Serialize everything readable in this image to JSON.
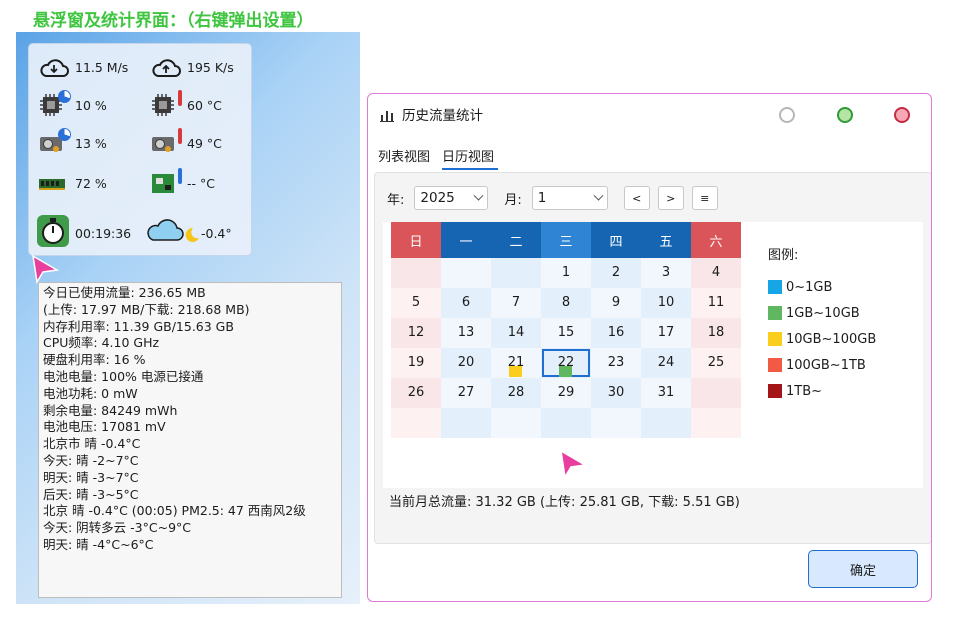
{
  "heading": "悬浮窗及统计界面：（右键弹出设置）",
  "float_window": {
    "net_down": "11.5 M/s",
    "net_up": "195 K/s",
    "cpu_usage": "10 %",
    "cpu_temp": "60 °C",
    "gpu_usage": "13 %",
    "gpu_temp": "49 °C",
    "memory_usage": "72 %",
    "board_temp": "-- °C",
    "uptime": "00:19:36",
    "weather_temp": "-0.4°"
  },
  "tooltip": {
    "lines": [
      "今日已使用流量: 236.65 MB",
      " (上传: 17.97 MB/下载: 218.68 MB)",
      "内存利用率: 11.39 GB/15.63 GB",
      "CPU频率: 4.10 GHz",
      "硬盘利用率: 16 %",
      "电池电量: 100% 电源已接通",
      "电池功耗:  0 mW",
      "剩余电量:  84249 mWh",
      "电池电压:  17081 mV",
      "北京市 晴 -0.4°C",
      "今天: 晴 -2~7°C",
      "明天: 晴 -3~7°C",
      "后天: 晴 -3~5°C",
      "北京 晴 -0.4°C (00:05) PM2.5: 47  西南风2级",
      "今天: 阴转多云 -3°C~9°C",
      "明天: 晴 -4°C~6°C"
    ]
  },
  "dialog": {
    "title": "历史流量统计",
    "tabs": [
      "列表视图",
      "日历视图"
    ],
    "active_tab": 1,
    "year_label": "年:",
    "year_value": "2025",
    "month_label": "月:",
    "month_value": "1",
    "prev_label": "<",
    "next_label": ">",
    "menu_label": "≡",
    "weekdays": [
      "日",
      "一",
      "二",
      "三",
      "四",
      "五",
      "六"
    ],
    "calendar_weeks": [
      [
        "",
        "",
        "",
        "1",
        "2",
        "3",
        "4"
      ],
      [
        "5",
        "6",
        "7",
        "8",
        "9",
        "10",
        "11"
      ],
      [
        "12",
        "13",
        "14",
        "15",
        "16",
        "17",
        "18"
      ],
      [
        "19",
        "20",
        "21",
        "22",
        "23",
        "24",
        "25"
      ],
      [
        "26",
        "27",
        "28",
        "29",
        "30",
        "31",
        ""
      ],
      [
        "",
        "",
        "",
        "",
        "",
        "",
        ""
      ]
    ],
    "today": "22",
    "day_markers": {
      "21": 2,
      "22": 1
    },
    "legend_title": "图例:",
    "legend": [
      {
        "label": "0~1GB",
        "color": "#16a6e6"
      },
      {
        "label": "1GB~10GB",
        "color": "#5fb85f"
      },
      {
        "label": "10GB~100GB",
        "color": "#fbcd1c"
      },
      {
        "label": "100GB~1TB",
        "color": "#f25a45"
      },
      {
        "label": "1TB~",
        "color": "#a31516"
      }
    ],
    "summary": "当前月总流量: 31.32 GB (上传: 25.81 GB, 下载: 5.51 GB)",
    "ok_label": "确定"
  },
  "colors": {
    "heading": "#3fc53f",
    "sunday_header": "#d9555a",
    "saturday_header": "#d9555a",
    "weekday_header_dark": "#1665b2",
    "weekday_header_mid": "#2f84d4",
    "cursor": "#e83f9f"
  }
}
